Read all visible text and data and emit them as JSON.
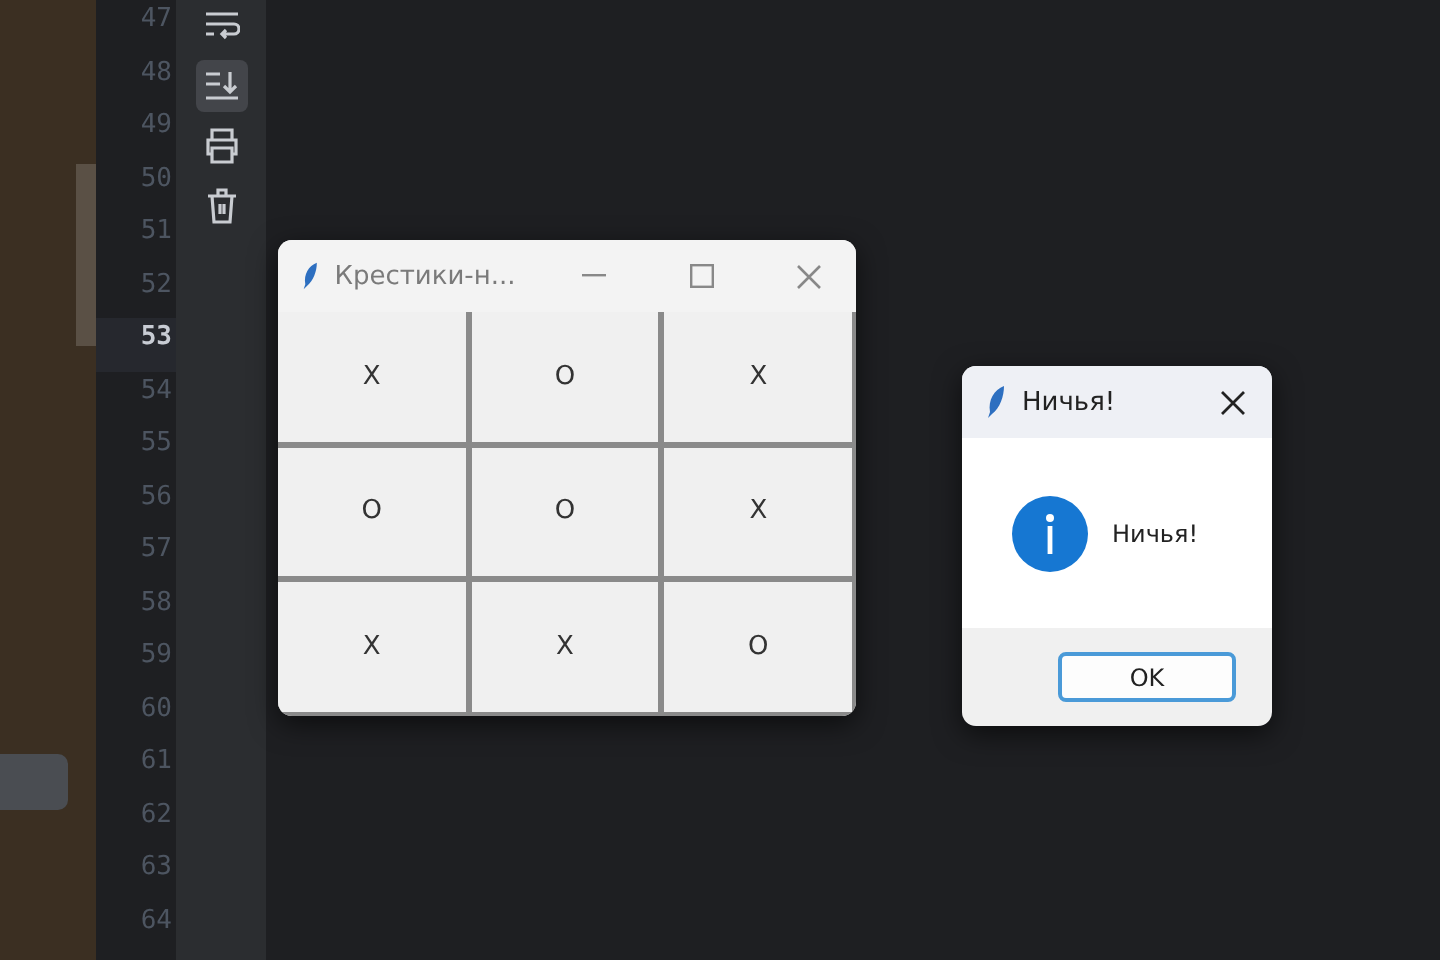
{
  "editor": {
    "line_numbers": [
      {
        "label": "47",
        "current": false
      },
      {
        "label": "48",
        "current": false
      },
      {
        "label": "49",
        "current": false
      },
      {
        "label": "50",
        "current": false
      },
      {
        "label": "51",
        "current": false
      },
      {
        "label": "52",
        "current": false
      },
      {
        "label": "53",
        "current": true
      },
      {
        "label": "54",
        "current": false
      },
      {
        "label": "55",
        "current": false
      },
      {
        "label": "56",
        "current": false
      },
      {
        "label": "57",
        "current": false
      },
      {
        "label": "58",
        "current": false
      },
      {
        "label": "59",
        "current": false
      },
      {
        "label": "60",
        "current": false
      },
      {
        "label": "61",
        "current": false
      },
      {
        "label": "62",
        "current": false
      },
      {
        "label": "63",
        "current": false
      },
      {
        "label": "64",
        "current": false
      }
    ],
    "toolbar": [
      {
        "kind": "wrap",
        "selected": false
      },
      {
        "kind": "scroll",
        "selected": true
      },
      {
        "kind": "print",
        "selected": false
      },
      {
        "kind": "trash",
        "selected": false
      }
    ]
  },
  "game_window": {
    "title": "Крестики-н...",
    "cells": [
      "X",
      "O",
      "X",
      "O",
      "O",
      "X",
      "X",
      "X",
      "O"
    ]
  },
  "dialog": {
    "title": "Ничья!",
    "message": "Ничья!",
    "button": "OK"
  }
}
